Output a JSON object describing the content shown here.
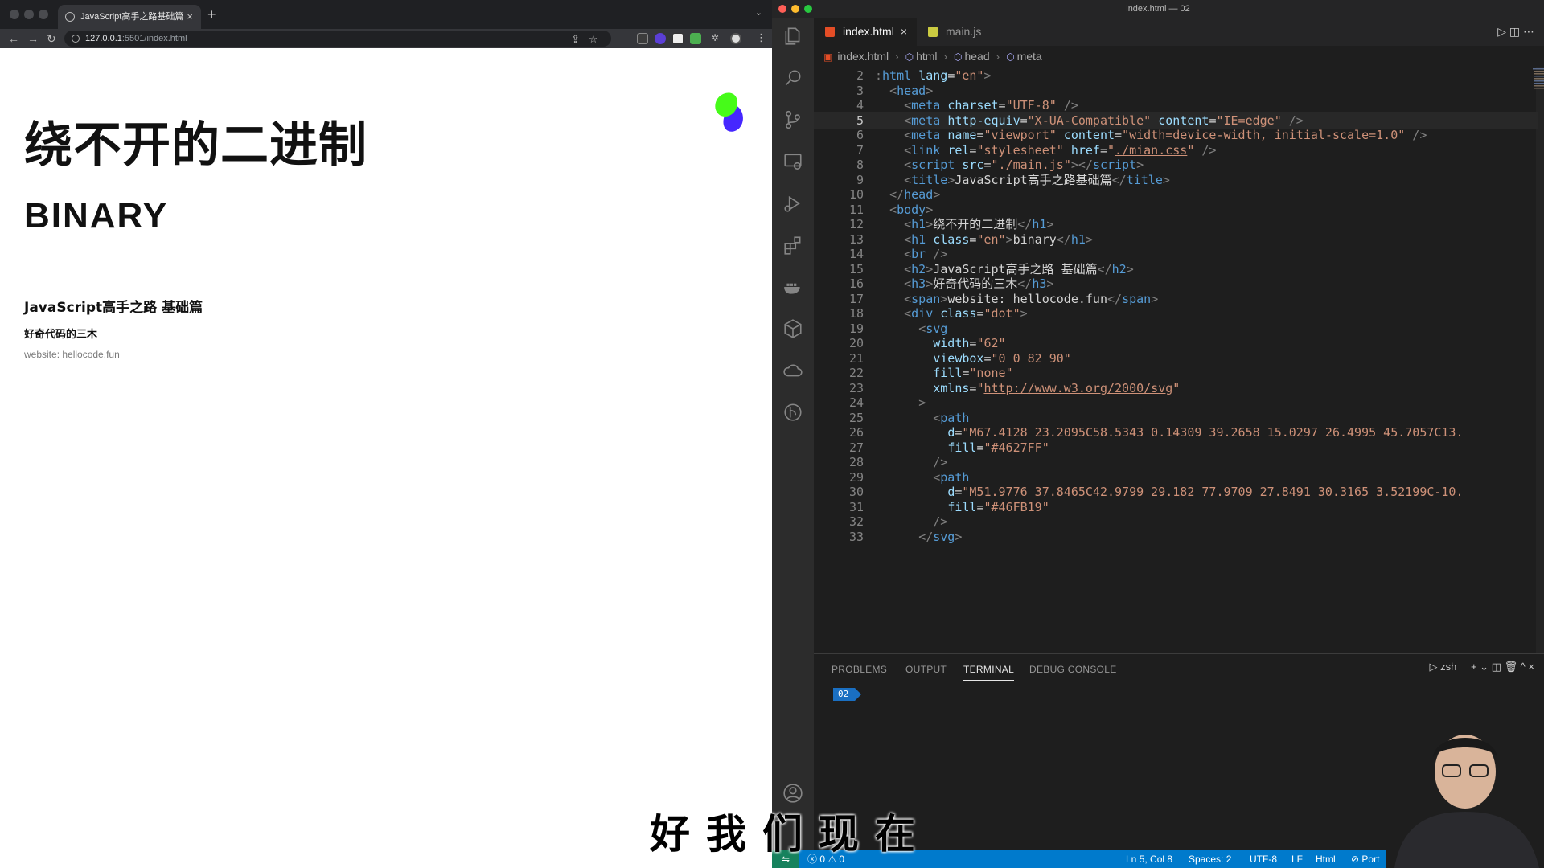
{
  "browser": {
    "tab_title": "JavaScript高手之路基础篇",
    "tab_close": "×",
    "new_tab": "+",
    "tab_menu": "⌄",
    "nav_back": "←",
    "nav_forward": "→",
    "nav_reload": "↻",
    "url_host": "127.0.0.1",
    "url_path": ":5501/index.html",
    "share_glyph": "⇪",
    "star_glyph": "☆",
    "ext_puzzle_glyph": "✲",
    "menu_glyph": "⋮",
    "page": {
      "h1": "绕不开的二进制",
      "h1_en": "binary",
      "h2": "JavaScript高手之路 基础篇",
      "h3": "好奇代码的三木",
      "span": "website: hellocode.fun",
      "dot_colors": [
        "#4627FF",
        "#46FB19"
      ]
    }
  },
  "vscode": {
    "window_title": "index.html — 02",
    "tabs": [
      {
        "label": "index.html",
        "icon_color": "#e44d26",
        "close": "×"
      },
      {
        "label": "main.js",
        "icon_color": "#cbcb41"
      }
    ],
    "tab_tools": "▷  ◫  ⋯",
    "breadcrumb": [
      "index.html",
      "html",
      "head",
      "meta"
    ],
    "breadcrumb_sep": "›",
    "breadcrumb_symbol": "⬡",
    "breadcrumb_file_glyph": "▣",
    "code_lines": [
      {
        "n": "2",
        "tokens": [
          [
            "p",
            ":"
          ],
          [
            "t",
            "html"
          ],
          [
            "tx",
            " "
          ],
          [
            "a",
            "lang"
          ],
          [
            "tx",
            "="
          ],
          [
            "s",
            "\"en\""
          ],
          [
            "p",
            ">"
          ]
        ]
      },
      {
        "n": "3",
        "tokens": [
          [
            "tx",
            "  "
          ],
          [
            "p",
            "<"
          ],
          [
            "t",
            "head"
          ],
          [
            "p",
            ">"
          ]
        ]
      },
      {
        "n": "4",
        "tokens": [
          [
            "tx",
            "    "
          ],
          [
            "p",
            "<"
          ],
          [
            "t",
            "meta"
          ],
          [
            "tx",
            " "
          ],
          [
            "a",
            "charset"
          ],
          [
            "tx",
            "="
          ],
          [
            "s",
            "\"UTF-8\""
          ],
          [
            "tx",
            " "
          ],
          [
            "p",
            "/>"
          ]
        ]
      },
      {
        "n": "5",
        "tokens": [
          [
            "tx",
            "    "
          ],
          [
            "p",
            "<"
          ],
          [
            "t",
            "meta"
          ],
          [
            "tx",
            " "
          ],
          [
            "a",
            "http-equiv"
          ],
          [
            "tx",
            "="
          ],
          [
            "s",
            "\"X-UA-Compatible\""
          ],
          [
            "tx",
            " "
          ],
          [
            "a",
            "content"
          ],
          [
            "tx",
            "="
          ],
          [
            "s",
            "\"IE=edge\""
          ],
          [
            "tx",
            " "
          ],
          [
            "p",
            "/>"
          ]
        ]
      },
      {
        "n": "6",
        "tokens": [
          [
            "tx",
            "    "
          ],
          [
            "p",
            "<"
          ],
          [
            "t",
            "meta"
          ],
          [
            "tx",
            " "
          ],
          [
            "a",
            "name"
          ],
          [
            "tx",
            "="
          ],
          [
            "s",
            "\"viewport\""
          ],
          [
            "tx",
            " "
          ],
          [
            "a",
            "content"
          ],
          [
            "tx",
            "="
          ],
          [
            "s",
            "\"width=device-width, initial-scale=1.0\""
          ],
          [
            "tx",
            " "
          ],
          [
            "p",
            "/>"
          ]
        ]
      },
      {
        "n": "7",
        "tokens": [
          [
            "tx",
            "    "
          ],
          [
            "p",
            "<"
          ],
          [
            "t",
            "link"
          ],
          [
            "tx",
            " "
          ],
          [
            "a",
            "rel"
          ],
          [
            "tx",
            "="
          ],
          [
            "s",
            "\"stylesheet\""
          ],
          [
            "tx",
            " "
          ],
          [
            "a",
            "href"
          ],
          [
            "tx",
            "="
          ],
          [
            "s",
            "\""
          ],
          [
            "su",
            "./mian.css"
          ],
          [
            "s",
            "\""
          ],
          [
            "tx",
            " "
          ],
          [
            "p",
            "/>"
          ]
        ]
      },
      {
        "n": "8",
        "tokens": [
          [
            "tx",
            "    "
          ],
          [
            "p",
            "<"
          ],
          [
            "t",
            "script"
          ],
          [
            "tx",
            " "
          ],
          [
            "a",
            "src"
          ],
          [
            "tx",
            "="
          ],
          [
            "s",
            "\""
          ],
          [
            "su",
            "./main.js"
          ],
          [
            "s",
            "\""
          ],
          [
            "p",
            "></"
          ],
          [
            "t",
            "script"
          ],
          [
            "p",
            ">"
          ]
        ]
      },
      {
        "n": "9",
        "tokens": [
          [
            "tx",
            "    "
          ],
          [
            "p",
            "<"
          ],
          [
            "t",
            "title"
          ],
          [
            "p",
            ">"
          ],
          [
            "tx",
            "JavaScript高手之路基础篇"
          ],
          [
            "p",
            "</"
          ],
          [
            "t",
            "title"
          ],
          [
            "p",
            ">"
          ]
        ]
      },
      {
        "n": "10",
        "tokens": [
          [
            "tx",
            "  "
          ],
          [
            "p",
            "</"
          ],
          [
            "t",
            "head"
          ],
          [
            "p",
            ">"
          ]
        ]
      },
      {
        "n": "11",
        "tokens": [
          [
            "tx",
            "  "
          ],
          [
            "p",
            "<"
          ],
          [
            "t",
            "body"
          ],
          [
            "p",
            ">"
          ]
        ]
      },
      {
        "n": "12",
        "tokens": [
          [
            "tx",
            "    "
          ],
          [
            "p",
            "<"
          ],
          [
            "t",
            "h1"
          ],
          [
            "p",
            ">"
          ],
          [
            "tx",
            "绕不开的二进制"
          ],
          [
            "p",
            "</"
          ],
          [
            "t",
            "h1"
          ],
          [
            "p",
            ">"
          ]
        ]
      },
      {
        "n": "13",
        "tokens": [
          [
            "tx",
            "    "
          ],
          [
            "p",
            "<"
          ],
          [
            "t",
            "h1"
          ],
          [
            "tx",
            " "
          ],
          [
            "a",
            "class"
          ],
          [
            "tx",
            "="
          ],
          [
            "s",
            "\"en\""
          ],
          [
            "p",
            ">"
          ],
          [
            "tx",
            "binary"
          ],
          [
            "p",
            "</"
          ],
          [
            "t",
            "h1"
          ],
          [
            "p",
            ">"
          ]
        ]
      },
      {
        "n": "14",
        "tokens": [
          [
            "tx",
            "    "
          ],
          [
            "p",
            "<"
          ],
          [
            "t",
            "br"
          ],
          [
            "tx",
            " "
          ],
          [
            "p",
            "/>"
          ]
        ]
      },
      {
        "n": "15",
        "tokens": [
          [
            "tx",
            "    "
          ],
          [
            "p",
            "<"
          ],
          [
            "t",
            "h2"
          ],
          [
            "p",
            ">"
          ],
          [
            "tx",
            "JavaScript高手之路 基础篇"
          ],
          [
            "p",
            "</"
          ],
          [
            "t",
            "h2"
          ],
          [
            "p",
            ">"
          ]
        ]
      },
      {
        "n": "16",
        "tokens": [
          [
            "tx",
            "    "
          ],
          [
            "p",
            "<"
          ],
          [
            "t",
            "h3"
          ],
          [
            "p",
            ">"
          ],
          [
            "tx",
            "好奇代码的三木"
          ],
          [
            "p",
            "</"
          ],
          [
            "t",
            "h3"
          ],
          [
            "p",
            ">"
          ]
        ]
      },
      {
        "n": "17",
        "tokens": [
          [
            "tx",
            "    "
          ],
          [
            "p",
            "<"
          ],
          [
            "t",
            "span"
          ],
          [
            "p",
            ">"
          ],
          [
            "tx",
            "website: hellocode.fun"
          ],
          [
            "p",
            "</"
          ],
          [
            "t",
            "span"
          ],
          [
            "p",
            ">"
          ]
        ]
      },
      {
        "n": "18",
        "tokens": [
          [
            "tx",
            "    "
          ],
          [
            "p",
            "<"
          ],
          [
            "t",
            "div"
          ],
          [
            "tx",
            " "
          ],
          [
            "a",
            "class"
          ],
          [
            "tx",
            "="
          ],
          [
            "s",
            "\"dot\""
          ],
          [
            "p",
            ">"
          ]
        ]
      },
      {
        "n": "19",
        "tokens": [
          [
            "tx",
            "      "
          ],
          [
            "p",
            "<"
          ],
          [
            "t",
            "svg"
          ]
        ]
      },
      {
        "n": "20",
        "tokens": [
          [
            "tx",
            "        "
          ],
          [
            "a",
            "width"
          ],
          [
            "tx",
            "="
          ],
          [
            "s",
            "\"62\""
          ]
        ]
      },
      {
        "n": "21",
        "tokens": [
          [
            "tx",
            "        "
          ],
          [
            "a",
            "viewbox"
          ],
          [
            "tx",
            "="
          ],
          [
            "s",
            "\"0 0 82 90\""
          ]
        ]
      },
      {
        "n": "22",
        "tokens": [
          [
            "tx",
            "        "
          ],
          [
            "a",
            "fill"
          ],
          [
            "tx",
            "="
          ],
          [
            "s",
            "\"none\""
          ]
        ]
      },
      {
        "n": "23",
        "tokens": [
          [
            "tx",
            "        "
          ],
          [
            "a",
            "xmlns"
          ],
          [
            "tx",
            "="
          ],
          [
            "s",
            "\""
          ],
          [
            "su",
            "http://www.w3.org/2000/svg"
          ],
          [
            "s",
            "\""
          ]
        ]
      },
      {
        "n": "24",
        "tokens": [
          [
            "tx",
            "      "
          ],
          [
            "p",
            ">"
          ]
        ]
      },
      {
        "n": "25",
        "tokens": [
          [
            "tx",
            "        "
          ],
          [
            "p",
            "<"
          ],
          [
            "t",
            "path"
          ]
        ]
      },
      {
        "n": "26",
        "tokens": [
          [
            "tx",
            "          "
          ],
          [
            "a",
            "d"
          ],
          [
            "tx",
            "="
          ],
          [
            "s",
            "\"M67.4128 23.2095C58.5343 0.14309 39.2658 15.0297 26.4995 45.7057C13."
          ]
        ]
      },
      {
        "n": "27",
        "tokens": [
          [
            "tx",
            "          "
          ],
          [
            "a",
            "fill"
          ],
          [
            "tx",
            "="
          ],
          [
            "s",
            "\"#4627FF\""
          ]
        ]
      },
      {
        "n": "28",
        "tokens": [
          [
            "tx",
            "        "
          ],
          [
            "p",
            "/>"
          ]
        ]
      },
      {
        "n": "29",
        "tokens": [
          [
            "tx",
            "        "
          ],
          [
            "p",
            "<"
          ],
          [
            "t",
            "path"
          ]
        ]
      },
      {
        "n": "30",
        "tokens": [
          [
            "tx",
            "          "
          ],
          [
            "a",
            "d"
          ],
          [
            "tx",
            "="
          ],
          [
            "s",
            "\"M51.9776 37.8465C42.9799 29.182 77.9709 27.8491 30.3165 3.52199C-10."
          ]
        ]
      },
      {
        "n": "31",
        "tokens": [
          [
            "tx",
            "          "
          ],
          [
            "a",
            "fill"
          ],
          [
            "tx",
            "="
          ],
          [
            "s",
            "\"#46FB19\""
          ]
        ]
      },
      {
        "n": "32",
        "tokens": [
          [
            "tx",
            "        "
          ],
          [
            "p",
            "/>"
          ]
        ]
      },
      {
        "n": "33",
        "tokens": [
          [
            "tx",
            "      "
          ],
          [
            "p",
            "</"
          ],
          [
            "t",
            "svg"
          ],
          [
            "p",
            ">"
          ]
        ]
      }
    ],
    "current_line": "5",
    "panel": {
      "tabs": [
        "PROBLEMS",
        "OUTPUT",
        "TERMINAL",
        "DEBUG CONSOLE"
      ],
      "active_tab": "TERMINAL",
      "shell": "zsh",
      "tools": "+ ⌄  ◫  🗑  ^  ×",
      "terminal_badge": "02"
    },
    "statusbar": {
      "remote": "⇋",
      "problems": "ⓧ 0 ⚠ 0",
      "position": "Ln 5, Col 8",
      "spaces": "Spaces: 2",
      "encoding": "UTF-8",
      "eol": "LF",
      "language": "Html",
      "port": "⊘ Port"
    }
  },
  "subtitle": "好我们现在",
  "colors": {
    "status_bar": "#007acc",
    "browser_chrome": "#35363a",
    "editor_bg": "#1e1e1e"
  }
}
